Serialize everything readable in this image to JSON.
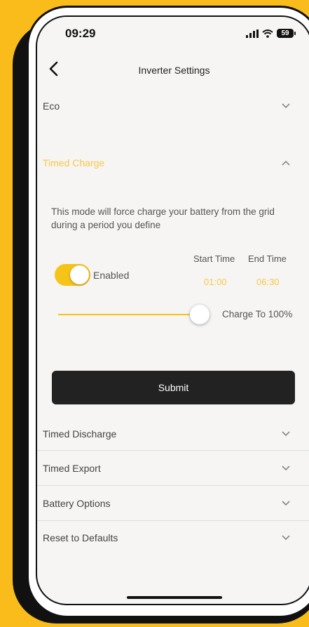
{
  "status_bar": {
    "time": "09:29",
    "battery": "59"
  },
  "nav": {
    "title": "Inverter Settings"
  },
  "sections": {
    "eco": {
      "label": "Eco"
    },
    "timed_charge": {
      "label": "Timed Charge",
      "description": "This mode will force charge your battery from the grid during a period you define",
      "start_time_label": "Start Time",
      "end_time_label": "End Time",
      "start_time": "01:00",
      "end_time": "06:30",
      "enabled_label": "Enabled",
      "enabled": true,
      "charge_to_label": "Charge To 100%",
      "charge_to_percent": 100,
      "submit_label": "Submit"
    },
    "timed_discharge": {
      "label": "Timed Discharge"
    },
    "timed_export": {
      "label": "Timed Export"
    },
    "battery_options": {
      "label": "Battery Options"
    },
    "reset_defaults": {
      "label": "Reset to Defaults"
    }
  },
  "colors": {
    "accent": "#F6C318",
    "background": "#F9BC1B",
    "button": "#222222"
  }
}
